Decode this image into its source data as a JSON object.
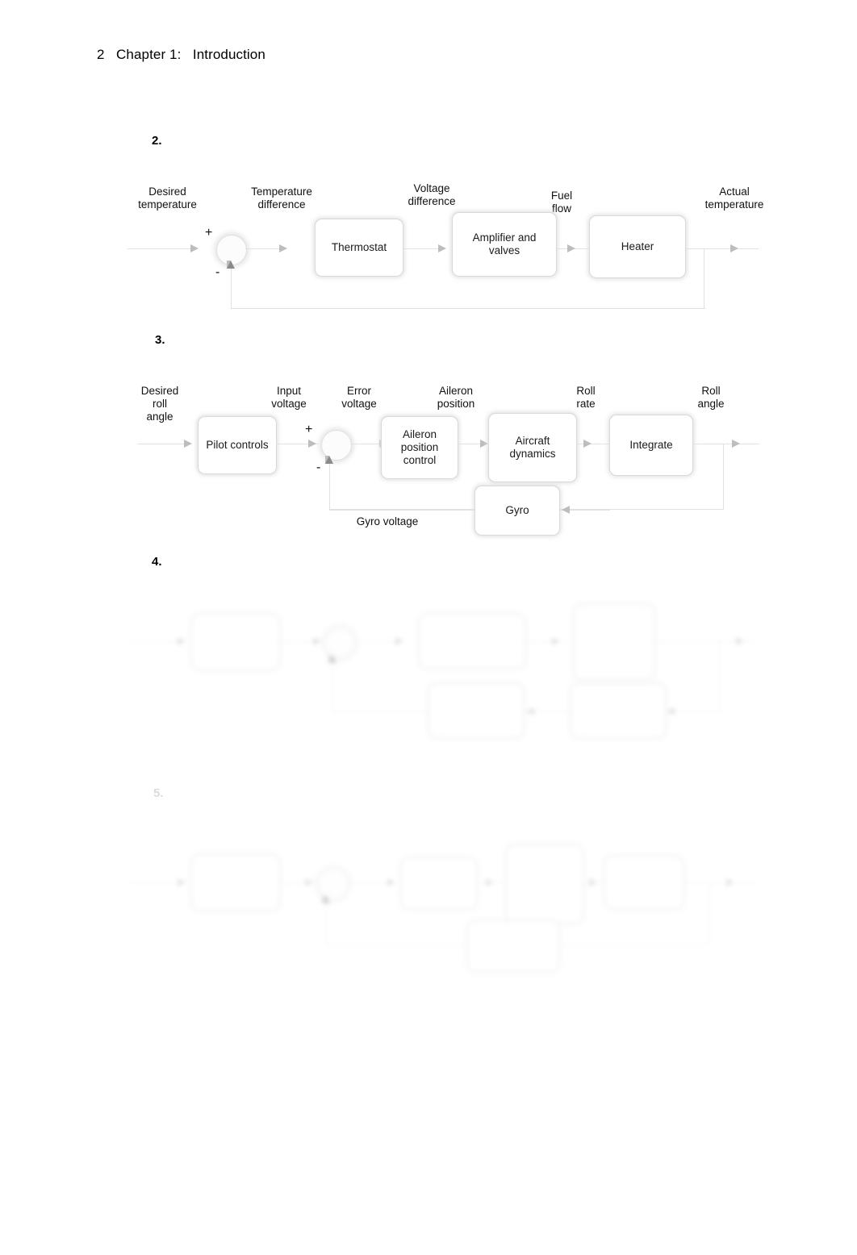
{
  "header": {
    "page_number": "2",
    "chapter": "Chapter 1:",
    "title": "Introduction",
    "full": "2   Chapter 1:   Introduction"
  },
  "problems": [
    {
      "number": "2."
    },
    {
      "number": "3."
    },
    {
      "number": "4."
    },
    {
      "number": "5."
    }
  ],
  "diagram2": {
    "problem": "2.",
    "blocks": [
      {
        "id": "thermostat",
        "label": "Thermostat"
      },
      {
        "id": "amplifier",
        "label": "Amplifier and\nvalves"
      },
      {
        "id": "heater",
        "label": "Heater"
      }
    ],
    "signals": [
      {
        "id": "input",
        "label": "Desired\ntemperature"
      },
      {
        "id": "error",
        "label": "Temperature\ndifference"
      },
      {
        "id": "voltage",
        "label": "Voltage\ndifference"
      },
      {
        "id": "fuel",
        "label": "Fuel\nflow"
      },
      {
        "id": "output",
        "label": "Actual\ntemperature"
      }
    ],
    "summer": {
      "plus": "+",
      "minus": "-"
    }
  },
  "diagram3": {
    "problem": "3.",
    "blocks": [
      {
        "id": "pilot-controls",
        "label": "Pilot\ncontrols"
      },
      {
        "id": "aileron-position-control",
        "label": "Aileron\nposition\ncontrol"
      },
      {
        "id": "aircraft-dynamics",
        "label": "Aircraft\ndynamics"
      },
      {
        "id": "integrate",
        "label": "Integrate"
      },
      {
        "id": "gyro",
        "label": "Gyro"
      }
    ],
    "signals": [
      {
        "id": "input",
        "label": "Desired\nroll\nangle"
      },
      {
        "id": "input-voltage",
        "label": "Input\nvoltage"
      },
      {
        "id": "error-voltage",
        "label": "Error\nvoltage"
      },
      {
        "id": "aileron-position",
        "label": "Aileron\nposition"
      },
      {
        "id": "roll-rate",
        "label": "Roll\nrate"
      },
      {
        "id": "roll-angle",
        "label": "Roll\nangle"
      },
      {
        "id": "gyro-voltage",
        "label": "Gyro voltage"
      }
    ],
    "summer": {
      "plus": "+",
      "minus": "-"
    }
  },
  "diagram4": {
    "problem": "4.",
    "legible": false,
    "blocks": [
      {
        "id": "b1",
        "label": ""
      },
      {
        "id": "b2",
        "label": ""
      },
      {
        "id": "b3",
        "label": ""
      },
      {
        "id": "b4",
        "label": ""
      },
      {
        "id": "b5",
        "label": ""
      }
    ],
    "signals": [
      {
        "id": "s1",
        "label": ""
      },
      {
        "id": "s2",
        "label": ""
      },
      {
        "id": "s3",
        "label": ""
      },
      {
        "id": "s4",
        "label": ""
      },
      {
        "id": "s5",
        "label": ""
      },
      {
        "id": "s6",
        "label": ""
      }
    ],
    "summer": {
      "plus": "",
      "minus": ""
    }
  },
  "diagram5": {
    "problem": "5.",
    "legible": false,
    "blocks": [
      {
        "id": "b1",
        "label": ""
      },
      {
        "id": "b2",
        "label": ""
      },
      {
        "id": "b3",
        "label": ""
      },
      {
        "id": "b4",
        "label": ""
      },
      {
        "id": "b5",
        "label": ""
      }
    ],
    "signals": [
      {
        "id": "s1",
        "label": ""
      },
      {
        "id": "s2",
        "label": ""
      },
      {
        "id": "s3",
        "label": ""
      },
      {
        "id": "s4",
        "label": ""
      },
      {
        "id": "s5",
        "label": ""
      },
      {
        "id": "s6",
        "label": ""
      }
    ],
    "summer": {
      "plus": "",
      "minus": ""
    }
  }
}
